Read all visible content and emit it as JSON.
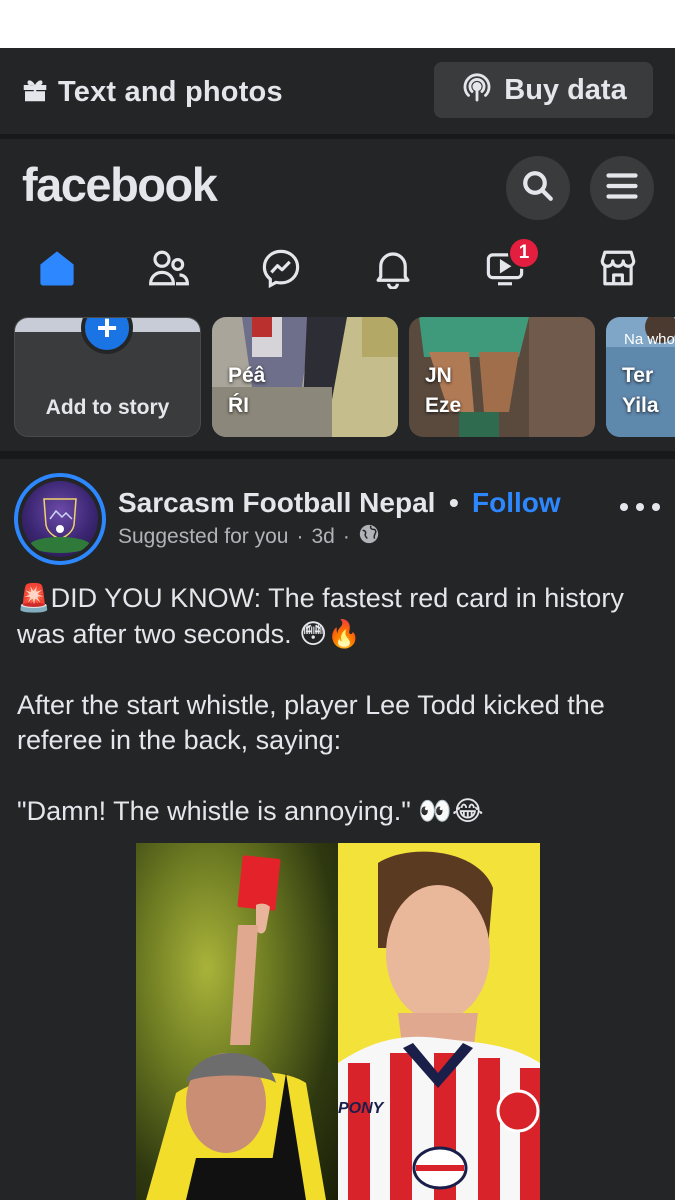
{
  "data_bar": {
    "mode_label": "Text and photos",
    "mode_icon": "gift-icon",
    "buy_label": "Buy data",
    "buy_icon": "podcast-icon"
  },
  "header": {
    "logo": "facebook",
    "search_icon": "search-icon",
    "menu_icon": "menu-icon"
  },
  "nav": {
    "items": [
      {
        "name": "home",
        "icon": "home-icon",
        "active": true
      },
      {
        "name": "friends",
        "icon": "friends-icon"
      },
      {
        "name": "messenger",
        "icon": "messenger-icon"
      },
      {
        "name": "notifications",
        "icon": "bell-icon"
      },
      {
        "name": "video",
        "icon": "video-icon",
        "badge": "1"
      },
      {
        "name": "marketplace",
        "icon": "marketplace-icon"
      }
    ]
  },
  "stories": {
    "add_label": "Add to story",
    "items": [
      {
        "name": "Péâ\nŔI"
      },
      {
        "name": "JN\nEze"
      },
      {
        "name": "Ter\nYila",
        "overlay": "Na who"
      }
    ]
  },
  "post": {
    "page_name": "Sarcasm Football Nepal",
    "separator": "•",
    "follow_label": "Follow",
    "suggested": "Suggested for you",
    "dot": "·",
    "time": "3d",
    "audience_icon": "globe-icon",
    "paragraphs": [
      "🚨DID YOU KNOW: The fastest red card in history was after two seconds. 😳🔥",
      "After the start whistle, player Lee Todd kicked the referee in the back, saying:",
      "\"Damn! The whistle is annoying.\" 👀😂"
    ],
    "image_text": "PONY"
  },
  "colors": {
    "background": "#242526",
    "accent": "#2d88ff",
    "badge": "#e41e3f"
  }
}
